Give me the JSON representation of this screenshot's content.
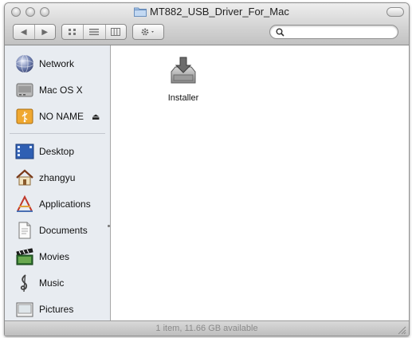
{
  "window": {
    "title": "MT882_USB_Driver_For_Mac"
  },
  "toolbar": {
    "back_label": "◀",
    "forward_label": "▶",
    "view_icons": [
      "icon-view-icon",
      "list-view-icon",
      "column-view-icon"
    ],
    "action_icon": "gear-icon",
    "search": {
      "value": "",
      "placeholder": ""
    }
  },
  "sidebar": {
    "devices": [
      {
        "label": "Network",
        "icon": "network-globe-icon"
      },
      {
        "label": "Mac OS X",
        "icon": "hard-drive-icon"
      },
      {
        "label": "NO NAME",
        "icon": "usb-drive-icon",
        "eject": "⏏"
      }
    ],
    "places": [
      {
        "label": "Desktop",
        "icon": "desktop-icon"
      },
      {
        "label": "zhangyu",
        "icon": "home-icon"
      },
      {
        "label": "Applications",
        "icon": "applications-icon"
      },
      {
        "label": "Documents",
        "icon": "documents-icon"
      },
      {
        "label": "Movies",
        "icon": "movies-icon"
      },
      {
        "label": "Music",
        "icon": "music-icon"
      },
      {
        "label": "Pictures",
        "icon": "pictures-icon"
      }
    ]
  },
  "content": {
    "items": [
      {
        "label": "Installer",
        "icon": "installer-package-icon"
      }
    ]
  },
  "status": {
    "text": "1 item, 11.66 GB available"
  },
  "colors": {
    "sidebar_bg": "#e8ecf1",
    "chrome": "#d4d4d4",
    "status_text": "#8a8a8a"
  }
}
